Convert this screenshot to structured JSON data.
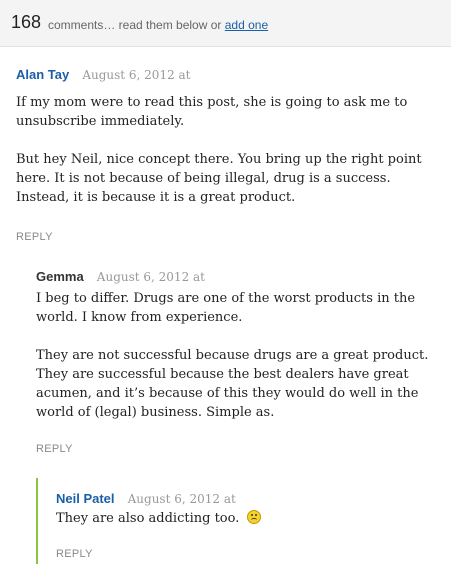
{
  "header": {
    "count": "168",
    "text": "comments… read them below or",
    "link": "add one"
  },
  "comments": [
    {
      "author": "Alan Tay",
      "date": "August 6, 2012 at",
      "paragraphs": [
        "If my mom were to read this post, she is going to ask me to unsubscribe immediately.",
        "But hey Neil, nice concept there. You bring up the right point here. It is not because of being illegal, drug is a success. Instead, it is because it is a great product."
      ],
      "reply": "REPLY"
    },
    {
      "author": "Gemma",
      "date": "August 6, 2012 at",
      "paragraphs": [
        "I beg to differ. Drugs are one of the worst products in the world. I know from experience.",
        "They are not successful because drugs are a great product. They are successful because the best dealers have great acumen, and it’s because of this they would do well in the world of (legal) business. Simple as."
      ],
      "reply": "REPLY"
    },
    {
      "author": "Neil Patel",
      "date": "August 6, 2012 at",
      "paragraphs": [
        "They are also addicting too."
      ],
      "emoticon": "sad-face-icon",
      "reply": "REPLY"
    }
  ],
  "colors": {
    "author_link": "#1a5fa8",
    "thread_bar": "#8cc63f",
    "header_bg": "#f4f4f4"
  }
}
